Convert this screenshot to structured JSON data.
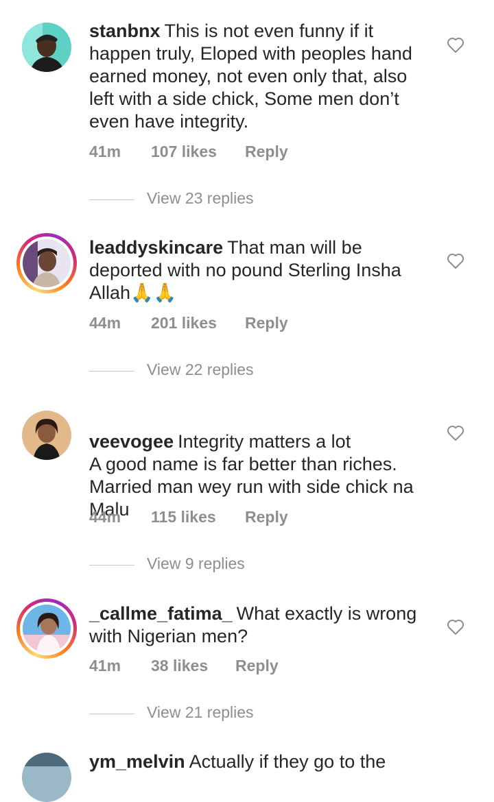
{
  "comments": [
    {
      "username": "stanbnx",
      "text": "This is not even funny if it happen truly, Eloped with peoples hand earned money, not even only that, also left with a side chick, Some men don’t even have integrity.",
      "time": "41m",
      "likes": "107 likes",
      "reply": "Reply",
      "view_replies": "View 23 replies",
      "story_ring": false
    },
    {
      "username": "leaddyskincare",
      "text": "That man will be deported with no pound Sterling Insha Allah🙏🙏",
      "time": "44m",
      "likes": "201 likes",
      "reply": "Reply",
      "view_replies": "View 22 replies",
      "story_ring": true
    },
    {
      "username": "veevogee",
      "text": "Integrity matters a lot\nA good name is far better than riches. Married man wey run with side chick na Malu",
      "time": "44m",
      "likes": "115 likes",
      "reply": "Reply",
      "view_replies": "View 9 replies",
      "story_ring": false
    },
    {
      "username": "_callme_fatima_",
      "text": "What exactly is wrong with Nigerian men?",
      "time": "41m",
      "likes": "38 likes",
      "reply": "Reply",
      "view_replies": "View 21 replies",
      "story_ring": true
    },
    {
      "username": "ym_melvin",
      "text": "Actually if they go to the",
      "story_ring": false
    }
  ],
  "colors": {
    "text": "#262626",
    "meta": "#8e8e8e",
    "divider": "#c7c7c7",
    "background": "#ffffff"
  },
  "icons": {
    "like": "heart-outline-icon",
    "emoji": "folded-hands-emoji"
  }
}
